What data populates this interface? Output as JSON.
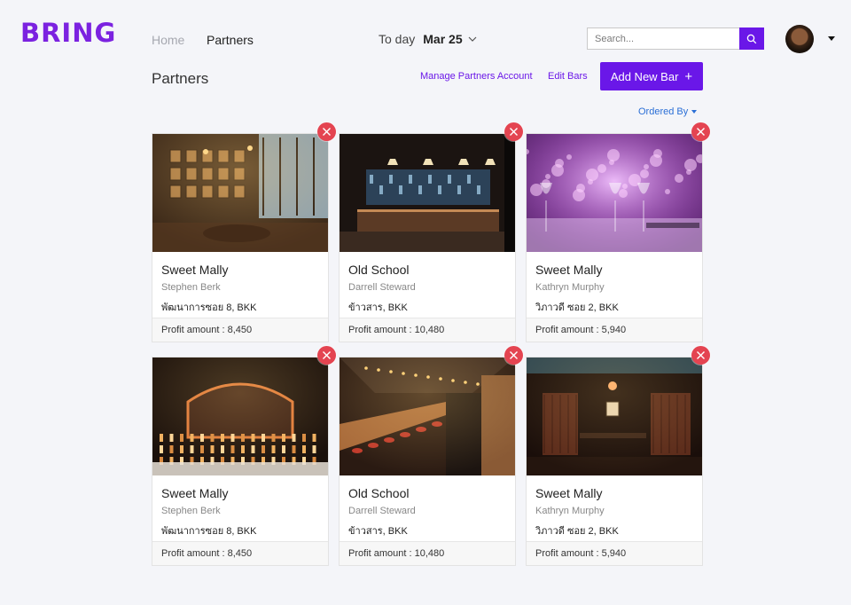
{
  "brand": {
    "logo": "BRING",
    "accent": "#6a17e8",
    "delete_color": "#e44451"
  },
  "nav": {
    "home": "Home",
    "partners": "Partners"
  },
  "date": {
    "label": "To day",
    "value": "Mar 25"
  },
  "search": {
    "placeholder": "Search...",
    "value": ""
  },
  "icons": {
    "search": "search-icon",
    "chevron": "chevron-down-icon",
    "delete": "close-icon",
    "user": "avatar"
  },
  "page": {
    "title": "Partners",
    "manage_link": "Manage Partners Account",
    "edit_link": "Edit Bars",
    "add_button": "Add New Bar",
    "add_icon": "+",
    "ordered_by": "Ordered By"
  },
  "cards": [
    {
      "name": "Sweet Mally",
      "owner": "Stephen  Berk",
      "address": "พัฒนาการซอย 8, BKK",
      "profit": "Profit amount : 8,450",
      "scene": "pub"
    },
    {
      "name": "Old School",
      "owner": "Darrell Steward",
      "address": "ข้าวสาร, BKK",
      "profit": "Profit amount : 10,480",
      "scene": "bar"
    },
    {
      "name": "Sweet Mally",
      "owner": "Kathryn Murphy",
      "address": "วิภาวดี ซอย 2, BKK",
      "profit": "Profit amount : 5,940",
      "scene": "lounge"
    },
    {
      "name": "Sweet Mally",
      "owner": "Stephen  Berk",
      "address": "พัฒนาการซอย 8, BKK",
      "profit": "Profit amount : 8,450",
      "scene": "arch"
    },
    {
      "name": "Old School",
      "owner": "Darrell Steward",
      "address": "ข้าวสาร, BKK",
      "profit": "Profit amount : 10,480",
      "scene": "counter"
    },
    {
      "name": "Sweet Mally",
      "owner": "Kathryn Murphy",
      "address": "วิภาวดี ซอย 2, BKK",
      "profit": "Profit amount : 5,940",
      "scene": "booth"
    }
  ]
}
